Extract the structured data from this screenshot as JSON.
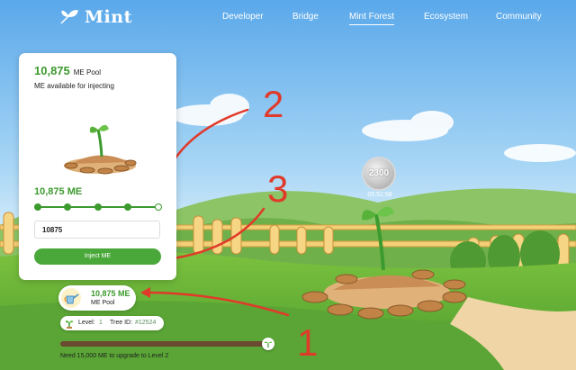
{
  "nav": {
    "brand": "Mint",
    "items": [
      "Developer",
      "Bridge",
      "Mint Forest",
      "Ecosystem",
      "Community"
    ],
    "active": "Mint Forest"
  },
  "panel": {
    "pool_value": "10,875",
    "pool_unit": "ME Pool",
    "subtitle": "ME available for injecting",
    "me_amount": "10,875 ME",
    "slider_steps": 5,
    "slider_selected_step": 5,
    "input_value": "10875",
    "inject_label": "Inject ME"
  },
  "pool_badge": {
    "value": "10,875 ME",
    "label": "ME Pool"
  },
  "tree": {
    "level_label": "Level:",
    "level_value": "1",
    "tree_id_label": "Tree ID:",
    "tree_id_value": "#12524"
  },
  "upgrade": {
    "progress": 0.95,
    "note": "Need 15,000 ME to upgrade to Level 2"
  },
  "coin": {
    "value": "2300",
    "timer": "05:51:56"
  },
  "annotations": [
    "1",
    "2",
    "3"
  ],
  "colors": {
    "accent_green": "#3c9a2e",
    "annotation_red": "#e03a2a",
    "sky_top": "#5aa8ea"
  },
  "icons": [
    "mint-leaf-icon",
    "watering-can-icon",
    "sprout-icon"
  ]
}
